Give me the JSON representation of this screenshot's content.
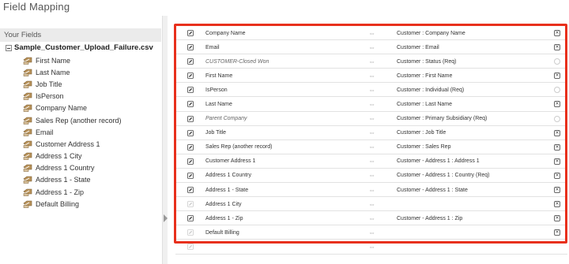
{
  "page_title": "Field Mapping",
  "left_panel": {
    "header": "Your Fields",
    "file_name": "Sample_Customer_Upload_Failure.csv",
    "fields": [
      "First Name",
      "Last Name",
      "Job Title",
      "IsPerson",
      "Company Name",
      "Sales Rep (another record)",
      "Email",
      "Customer Address 1",
      "Address 1 City",
      "Address 1 Country",
      "Address 1 - State",
      "Address 1 - Zip",
      "Default Billing"
    ]
  },
  "mappings": [
    {
      "source": "Company Name",
      "target": "Customer : Company Name",
      "italic": false,
      "deletable": true
    },
    {
      "source": "Email",
      "target": "Customer : Email",
      "italic": false,
      "deletable": true
    },
    {
      "source": "CUSTOMER-Closed Won",
      "target": "Customer : Status (Req)",
      "italic": true,
      "deletable": false
    },
    {
      "source": "First Name",
      "target": "Customer : First Name",
      "italic": false,
      "deletable": true
    },
    {
      "source": "IsPerson",
      "target": "Customer : Individual (Req)",
      "italic": false,
      "deletable": false
    },
    {
      "source": "Last Name",
      "target": "Customer : Last Name",
      "italic": false,
      "deletable": true
    },
    {
      "source": "Parent Company",
      "target": "Customer : Primary Subsidiary (Req)",
      "italic": true,
      "deletable": false
    },
    {
      "source": "Job Title",
      "target": "Customer : Job Title",
      "italic": false,
      "deletable": true
    },
    {
      "source": "Sales Rep (another record)",
      "target": "Customer : Sales Rep",
      "italic": false,
      "deletable": true
    },
    {
      "source": "Customer Address 1",
      "target": "Customer - Address 1 : Address 1",
      "italic": false,
      "deletable": true
    },
    {
      "source": "Address 1 Country",
      "target": "Customer - Address 1 : Country (Req)",
      "italic": false,
      "deletable": true
    },
    {
      "source": "Address 1 - State",
      "target": "Customer - Address 1 : State",
      "italic": false,
      "deletable": true
    },
    {
      "source": "Address 1 City",
      "target": "",
      "italic": false,
      "deletable": true
    },
    {
      "source": "Address 1 - Zip",
      "target": "Customer - Address 1 : Zip",
      "italic": false,
      "deletable": true
    },
    {
      "source": "Default Billing",
      "target": "",
      "italic": false,
      "deletable": true
    },
    {
      "source": "",
      "target": "",
      "italic": false,
      "deletable": false
    }
  ],
  "colors": {
    "highlight": "#e8301c",
    "field_icon": "#b8925a"
  },
  "icons": {
    "field": "pencil-tag-icon",
    "edit": "edit-icon",
    "map_arrow": "double-arrow-icon",
    "delete": "delete-icon"
  }
}
